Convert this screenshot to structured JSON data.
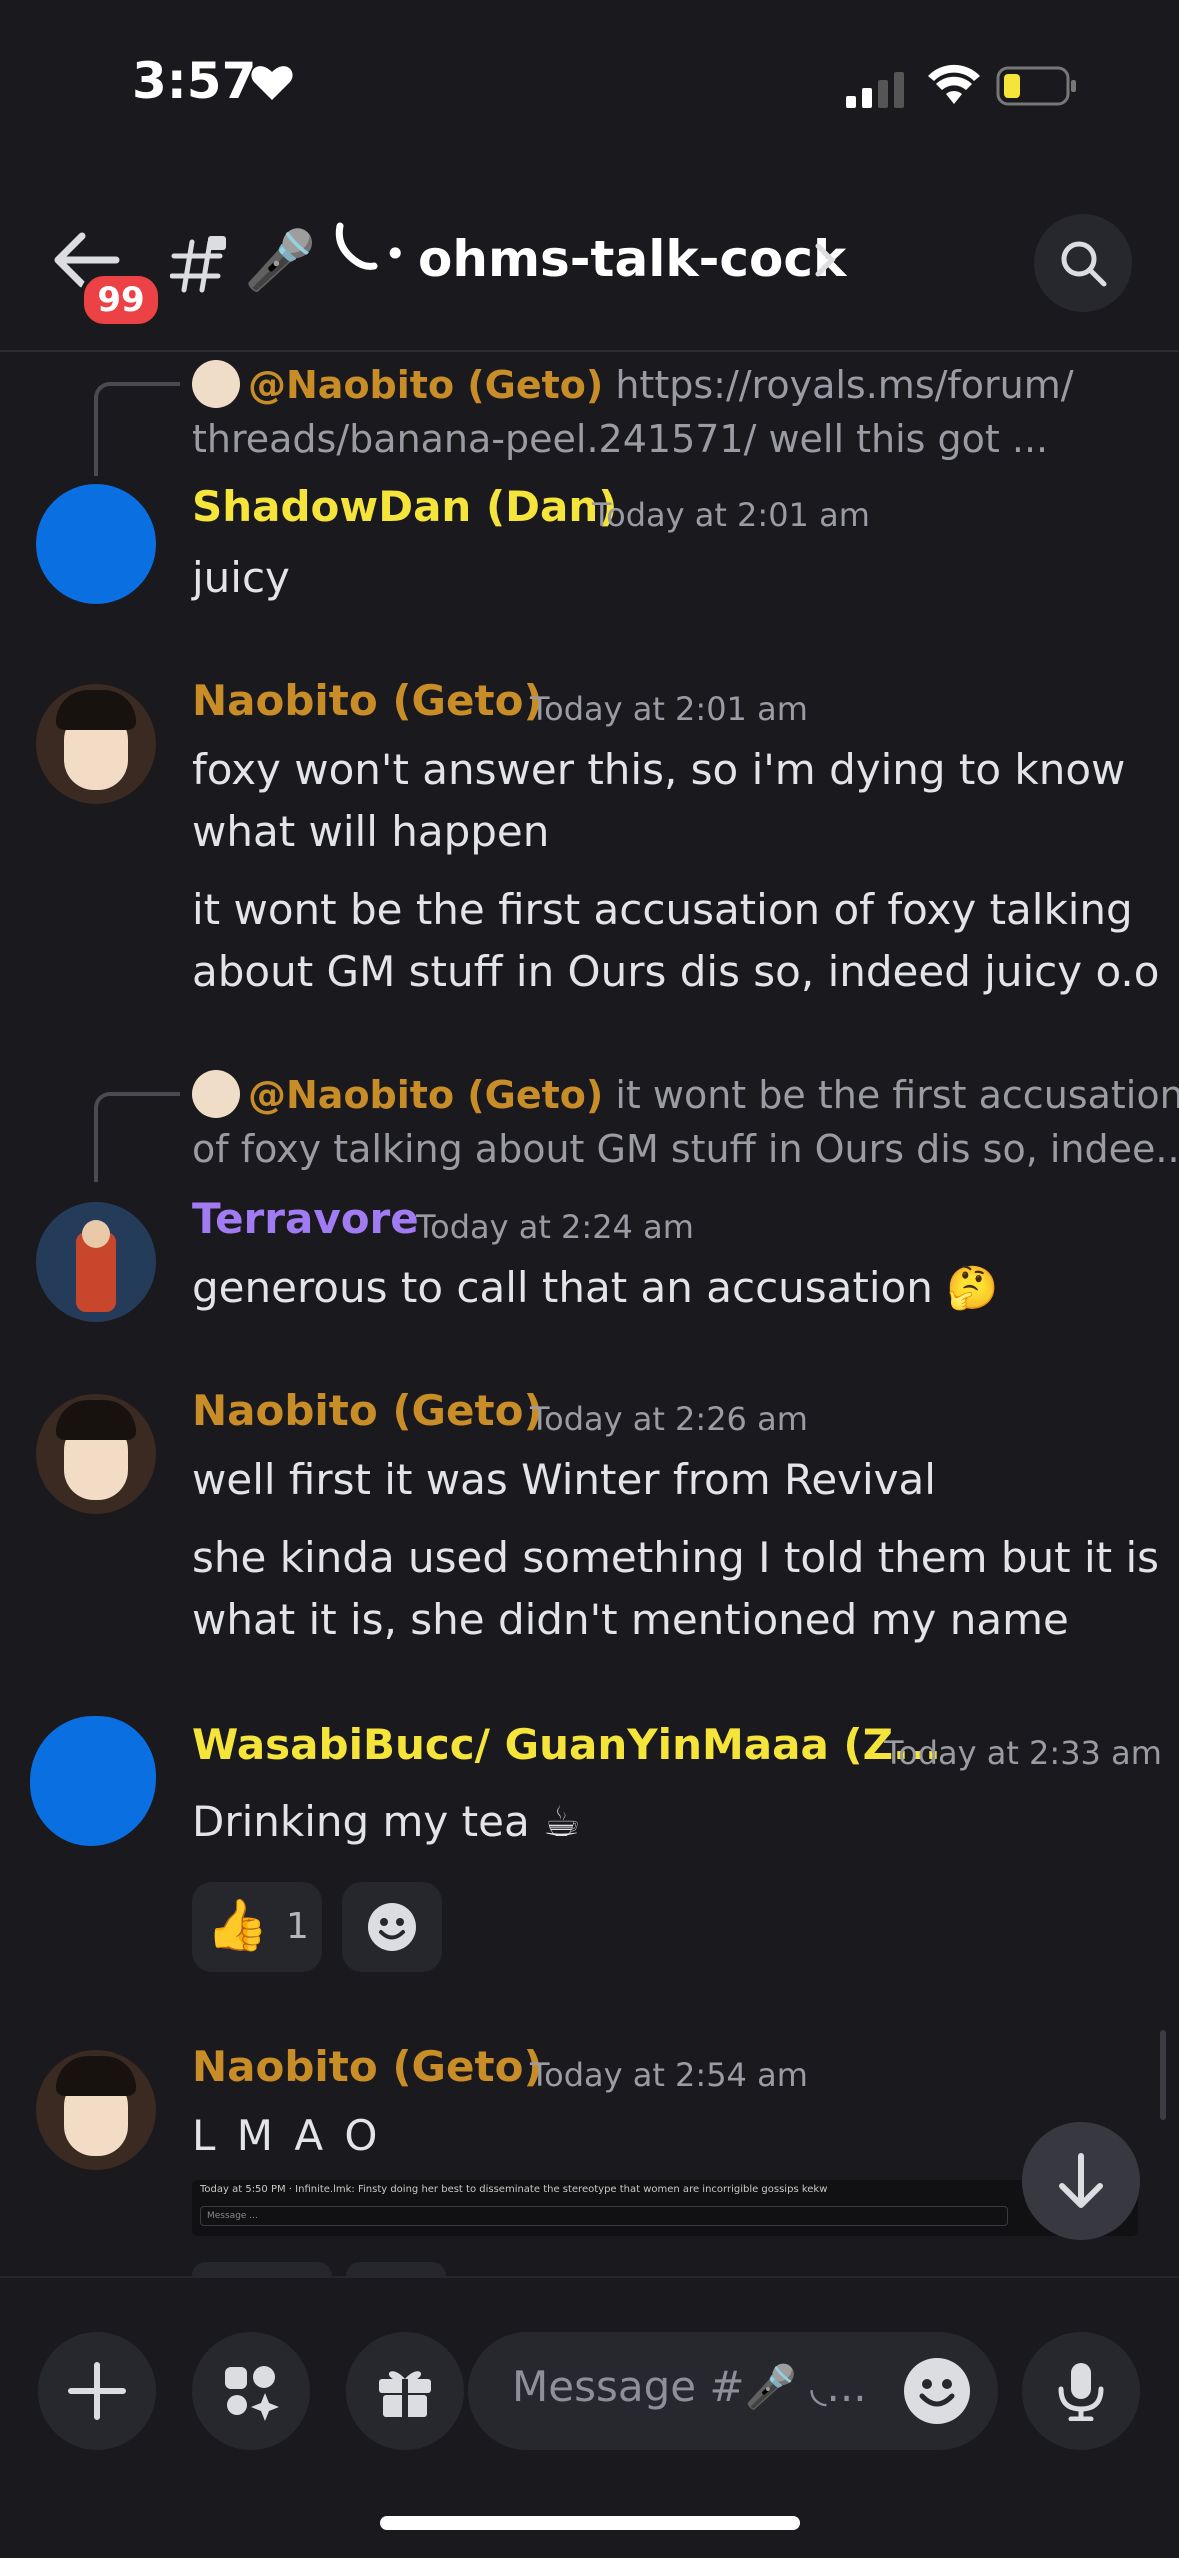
{
  "status_bar": {
    "time": "3:57"
  },
  "header": {
    "back_badge": "99",
    "channel_name": "ohms-talk-cock"
  },
  "messages": [
    {
      "reply": {
        "mention": "@Naobito (Geto)",
        "line1": "https://royals.ms/forum/",
        "line2": "threads/banana-peel.241571/ well this got ..."
      },
      "author": "ShadowDan (Dan)",
      "author_color": "#f5e43a",
      "time": "Today at 2:01 am",
      "lines": [
        "juicy"
      ]
    },
    {
      "author": "Naobito (Geto)",
      "author_color": "#c98d28",
      "time": "Today at 2:01 am",
      "lines": [
        "foxy won't answer this, so i'm dying to know",
        "what will happen",
        "it wont be the first accusation of foxy talking",
        "about GM stuff in Ours dis so, indeed juicy o.o"
      ]
    },
    {
      "reply": {
        "mention": "@Naobito (Geto)",
        "line1": "it wont be the first accusation",
        "line2": "of foxy talking about GM stuff in Ours dis so, indee..."
      },
      "author": "Terravore",
      "author_color": "#a17bf2",
      "time": "Today at 2:24 am",
      "lines": [
        "generous to call that an accusation 🤔"
      ]
    },
    {
      "author": "Naobito (Geto)",
      "author_color": "#c98d28",
      "time": "Today at 2:26 am",
      "lines": [
        "well first it was Winter from Revival",
        "she kinda used something I told them but it is",
        "what it is, she didn't mentioned my name"
      ]
    },
    {
      "author": "WasabiBucc/ GuanYinMaaa (Z...",
      "author_color": "#f5e43a",
      "time": "Today at 2:33 am",
      "lines": [
        "Drinking my tea ☕"
      ],
      "reactions": [
        {
          "emoji": "👍",
          "count": "1"
        }
      ]
    },
    {
      "author": "Naobito (Geto)",
      "author_color": "#c98d28",
      "time": "Today at 2:54 am",
      "lines": [
        "L M A O"
      ],
      "embed_text": "Today at 5:50 PM · Infinite.lmk: Finsty doing her best to disseminate the stereotype that women are incorrigible gossips kekw",
      "embed_input": "Message ..."
    }
  ],
  "composer": {
    "placeholder": "Message #🎤 ◟..."
  }
}
